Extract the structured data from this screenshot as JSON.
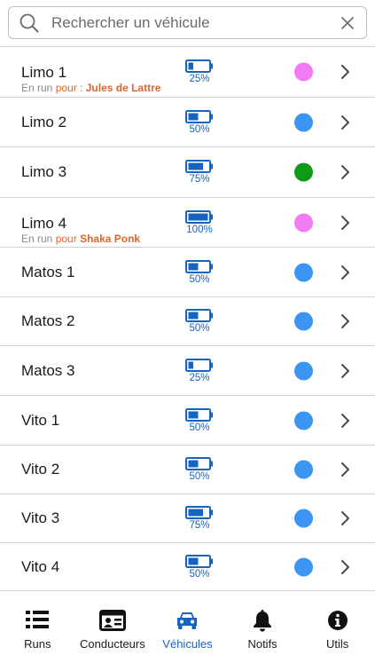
{
  "search": {
    "placeholder": "Rechercher un véhicule",
    "value": ""
  },
  "colors": {
    "accent": "#1565c0",
    "status_blue": "#3d95f3",
    "status_green": "#0f9a17",
    "status_pink": "#f27af3",
    "run_orange": "#e0662a"
  },
  "vehicles": [
    {
      "name": "Limo 1",
      "battery_pct": "25%",
      "battery_level": 0.25,
      "status_color": "#f27af3",
      "run_label": "En run",
      "run_pour": "pour :",
      "run_driver": "Jules de Lattre"
    },
    {
      "name": "Limo 2",
      "battery_pct": "50%",
      "battery_level": 0.5,
      "status_color": "#3d95f3"
    },
    {
      "name": "Limo 3",
      "battery_pct": "75%",
      "battery_level": 0.75,
      "status_color": "#0f9a17"
    },
    {
      "name": "Limo 4",
      "battery_pct": "100%",
      "battery_level": 1.0,
      "status_color": "#f27af3",
      "run_label": "En run",
      "run_pour": "pour",
      "run_driver": "Shaka Ponk"
    },
    {
      "name": "Matos 1",
      "battery_pct": "50%",
      "battery_level": 0.5,
      "status_color": "#3d95f3"
    },
    {
      "name": "Matos 2",
      "battery_pct": "50%",
      "battery_level": 0.5,
      "status_color": "#3d95f3"
    },
    {
      "name": "Matos 3",
      "battery_pct": "25%",
      "battery_level": 0.25,
      "status_color": "#3d95f3"
    },
    {
      "name": "Vito 1",
      "battery_pct": "50%",
      "battery_level": 0.5,
      "status_color": "#3d95f3"
    },
    {
      "name": "Vito 2",
      "battery_pct": "50%",
      "battery_level": 0.5,
      "status_color": "#3d95f3"
    },
    {
      "name": "Vito 3",
      "battery_pct": "75%",
      "battery_level": 0.75,
      "status_color": "#3d95f3"
    },
    {
      "name": "Vito 4",
      "battery_pct": "50%",
      "battery_level": 0.5,
      "status_color": "#3d95f3"
    }
  ],
  "nav": {
    "items": [
      {
        "label": "Runs",
        "icon": "list-icon",
        "active": false
      },
      {
        "label": "Conducteurs",
        "icon": "id-card-icon",
        "active": false
      },
      {
        "label": "Véhicules",
        "icon": "car-icon",
        "active": true
      },
      {
        "label": "Notifs",
        "icon": "bell-icon",
        "active": false
      },
      {
        "label": "Utils",
        "icon": "info-icon",
        "active": false
      }
    ]
  }
}
